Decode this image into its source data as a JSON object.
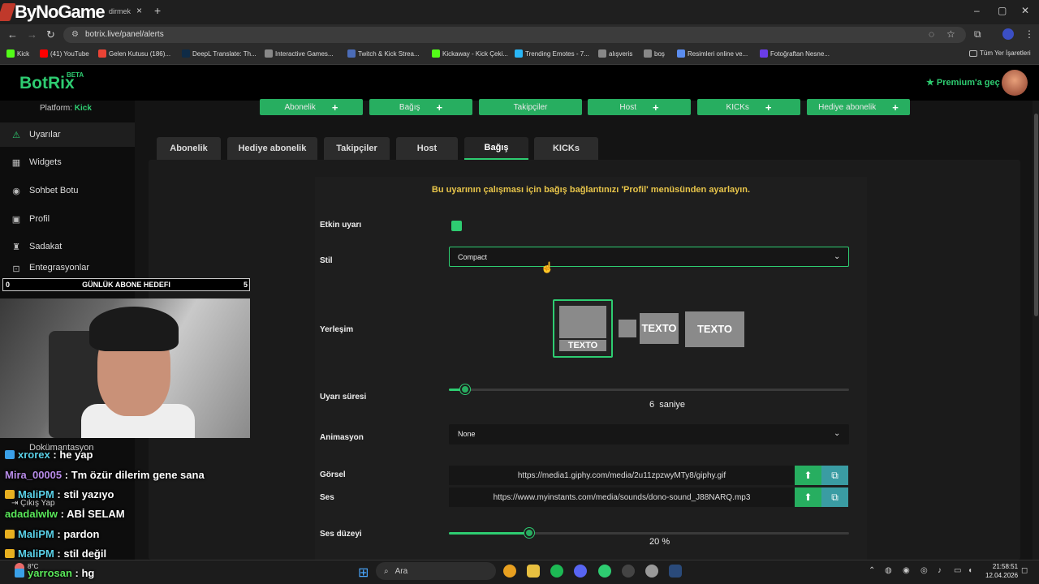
{
  "browser": {
    "overlay_logo": "ByNoGame",
    "tab_title": "dirmek",
    "tab_close": "×",
    "new_tab": "+",
    "window_controls": [
      "–",
      "▢",
      "✕"
    ],
    "nav": {
      "back": "←",
      "forward": "→",
      "reload": "↻"
    },
    "url": "botrix.live/panel/alerts",
    "bookmarks": [
      {
        "label": "Kick",
        "color": "#53fc18"
      },
      {
        "label": "(41) YouTube",
        "color": "#ff0000"
      },
      {
        "label": "Gelen Kutusu (186)...",
        "color": "#ea4335"
      },
      {
        "label": "DeepL Translate: Th...",
        "color": "#0f2b46"
      },
      {
        "label": "Interactive Games...",
        "color": "#888888"
      },
      {
        "label": "Twitch & Kick Strea...",
        "color": "#4b6cb7"
      },
      {
        "label": "Kickaway - Kick Çeki...",
        "color": "#53fc18"
      },
      {
        "label": "Trending Emotes - 7...",
        "color": "#29b6f6"
      },
      {
        "label": "alışveris",
        "color": "#888888"
      },
      {
        "label": "boş",
        "color": "#888888"
      },
      {
        "label": "Resimleri online ve...",
        "color": "#5b8def"
      },
      {
        "label": "Fotoğraftan Nesne...",
        "color": "#6a3de8"
      }
    ],
    "all_bookmarks": "Tüm Yer İşaretleri"
  },
  "header": {
    "brand": "BotRix",
    "beta": "BETA",
    "premium": "Premium'a geç"
  },
  "sidebar": {
    "platform_label": "Platform:",
    "platform_value": "Kick",
    "items": [
      {
        "label": "Uyarılar",
        "icon": "warning-icon"
      },
      {
        "label": "Widgets",
        "icon": "grid-icon"
      },
      {
        "label": "Sohbet Botu",
        "icon": "robot-icon"
      },
      {
        "label": "Profil",
        "icon": "id-card-icon"
      },
      {
        "label": "Sadakat",
        "icon": "trophy-icon"
      },
      {
        "label": "Entegrasyonlar",
        "icon": "plug-icon"
      }
    ],
    "bottom": {
      "docs": "Dokümantasyon",
      "logout": "Çıkış Yap"
    }
  },
  "add_buttons": [
    "Abonelik",
    "Bağış",
    "Takipçiler",
    "Host",
    "KICKs",
    "Hediye abonelik"
  ],
  "tabs": [
    "Abonelik",
    "Hediye abonelik",
    "Takipçiler",
    "Host",
    "Bağış",
    "KICKs"
  ],
  "active_tab": "Bağış",
  "form": {
    "notice": "Bu uyarının çalışması için bağış bağlantınızı 'Profil' menüsünden ayarlayın.",
    "enabled_label": "Etkin uyarı",
    "enabled": true,
    "style_label": "Stil",
    "style_value": "Compact",
    "layout_label": "Yerleşim",
    "layout_text": "TEXTO",
    "duration_label": "Uyarı süresi",
    "duration_value": "6",
    "duration_unit": "saniye",
    "animation_label": "Animasyon",
    "animation_value": "None",
    "image_label": "Görsel",
    "image_url": "https://media1.giphy.com/media/2u11zpzwyMTy8/giphy.gif",
    "sound_label": "Ses",
    "sound_url": "https://www.myinstants.com/media/sounds/dono-sound_J88NARQ.mp3",
    "volume_label": "Ses düzeyi",
    "volume_value": "20",
    "volume_unit": "%",
    "volume_fraction": 0.2
  },
  "stream": {
    "goal_min": "0",
    "goal_title": "GÜNLÜK ABONE HEDEFI",
    "goal_max": "5",
    "chat": [
      {
        "name": "xrorex",
        "text": ": he yap"
      },
      {
        "name": "Mira_00005",
        "text": ": Tm özür dilerim gene sana"
      },
      {
        "name": "MaliPM",
        "text": ": stil yazıyo"
      },
      {
        "name": "adadalwlw",
        "text": ": ABİ SELAM"
      },
      {
        "name": "MaliPM",
        "text": ": pardon"
      },
      {
        "name": "MaliPM",
        "text": ": stil değil"
      },
      {
        "name": "yarrosan",
        "text": ": hg"
      }
    ]
  },
  "taskbar": {
    "weather": "8°C",
    "search": "Ara",
    "time": "21:58:51",
    "date": "12.04.2026"
  },
  "colors": {
    "accent": "#2ecc71",
    "notice": "#e8c54a",
    "button": "#27ae60"
  }
}
